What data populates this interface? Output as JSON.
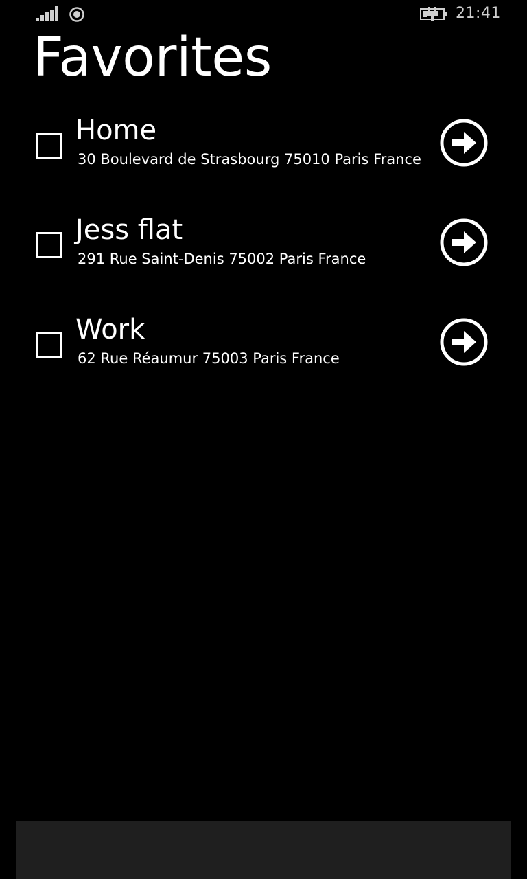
{
  "status_bar": {
    "time": "21:41",
    "signal_icon": "signal-strength-icon",
    "location_icon": "location-icon",
    "battery_icon": "battery-charging-icon"
  },
  "page": {
    "title": "Favorites"
  },
  "favorites": [
    {
      "name": "Home",
      "address": "30 Boulevard de Strasbourg 75010 Paris France",
      "checked": false,
      "action_icon": "arrow-right-circle-icon"
    },
    {
      "name": "Jess flat",
      "address": "291 Rue Saint-Denis 75002 Paris France",
      "checked": false,
      "action_icon": "arrow-right-circle-icon"
    },
    {
      "name": "Work",
      "address": "62 Rue Réaumur 75003 Paris France",
      "checked": false,
      "action_icon": "arrow-right-circle-icon"
    }
  ],
  "colors": {
    "background": "#000000",
    "foreground": "#ffffff",
    "app_bar": "#1f1f1f"
  }
}
